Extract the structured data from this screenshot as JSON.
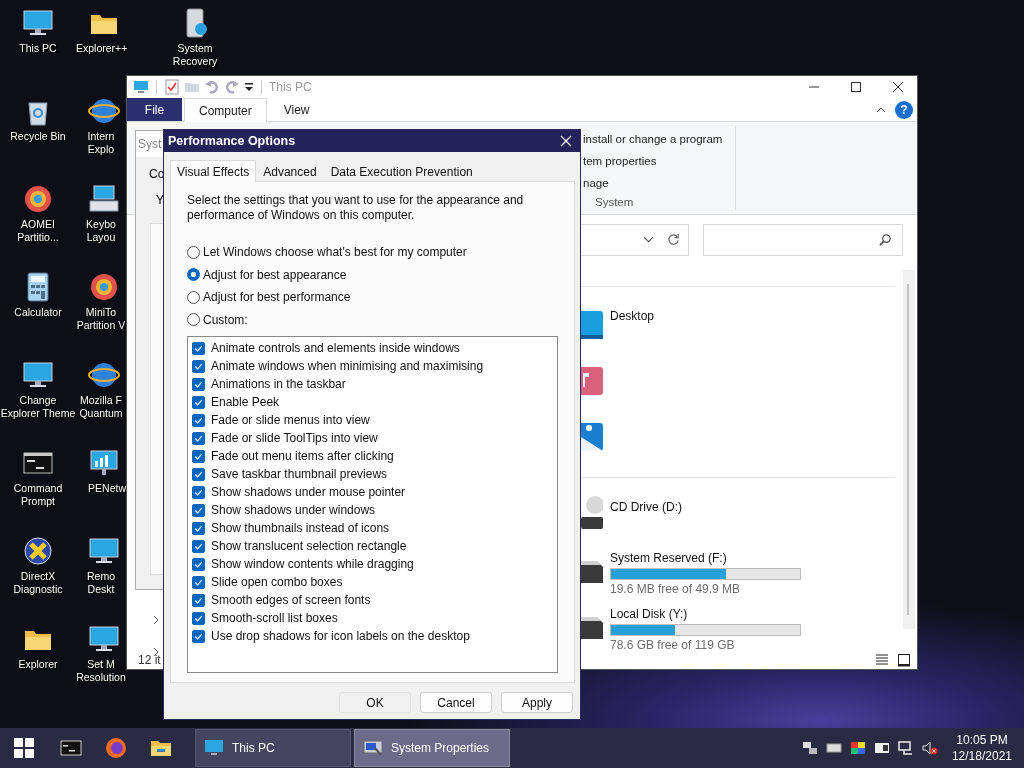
{
  "desktop": {
    "columns": [
      {
        "icons": [
          {
            "label": "This PC",
            "kind": "monitor"
          },
          {
            "label": "Recycle Bin",
            "kind": "bin"
          },
          {
            "label": "AOMEI Partitio...",
            "kind": "disc"
          },
          {
            "label": "Calculator",
            "kind": "calculator"
          },
          {
            "label": "Change Explorer Theme",
            "kind": "monitor"
          },
          {
            "label": "Command Prompt",
            "kind": "terminal"
          },
          {
            "label": "DirectX Diagnostic",
            "kind": "cross"
          },
          {
            "label": "Explorer",
            "kind": "folder"
          }
        ]
      },
      {
        "icons": [
          {
            "label": "Explorer++",
            "kind": "folder"
          },
          {
            "label": "Intern Explo",
            "kind": "globe"
          },
          {
            "label": "Keybo Layou",
            "kind": "keyboard"
          },
          {
            "label": "MiniTo Partition V",
            "kind": "disc"
          },
          {
            "label": "Mozilla F Quantum",
            "kind": "globe"
          },
          {
            "label": "PENetw",
            "kind": "network"
          },
          {
            "label": "Remo Deskt",
            "kind": "monitor"
          },
          {
            "label": "Set M Resolution",
            "kind": "monitor"
          }
        ]
      },
      {
        "icons": [
          {
            "label": "System Recovery",
            "kind": "drive"
          }
        ]
      }
    ]
  },
  "explorer": {
    "title": "This PC",
    "ribbon_tabs": [
      {
        "label": "File",
        "kind": "file",
        "selected": false
      },
      {
        "label": "Computer",
        "kind": "tab",
        "selected": true
      },
      {
        "label": "View",
        "kind": "tab",
        "selected": false
      }
    ],
    "help": "?",
    "ribbon_items": [
      "install or change a program",
      "tem properties",
      "nage"
    ],
    "ribbon_group": "System",
    "folders": [
      {
        "label": "Desktop",
        "kind": "desktop"
      },
      {
        "kind": "music"
      },
      {
        "kind": "pictures"
      }
    ],
    "drives": [
      {
        "label": "CD Drive (D:)",
        "kind": "cd"
      },
      {
        "label": "System Reserved (F:)",
        "kind": "disk",
        "level": 0.61,
        "free": "19.6 MB free of 49.9 MB"
      },
      {
        "label": "Local Disk (Y:)",
        "kind": "disk",
        "level": 0.34,
        "free": "78.6 GB free of 119 GB"
      }
    ],
    "status": "12 it"
  },
  "background_window": {
    "title": "Syst",
    "tab": "Co",
    "text": "Y"
  },
  "dialog": {
    "title": "Performance Options",
    "tabs": [
      {
        "label": "Visual Effects",
        "selected": true
      },
      {
        "label": "Advanced",
        "selected": false
      },
      {
        "label": "Data Execution Prevention",
        "selected": false
      }
    ],
    "intro": "Select the settings that you want to use for the appearance and performance of Windows on this computer.",
    "options": [
      {
        "label": "Let Windows choose what's best for my computer",
        "selected": false
      },
      {
        "label": "Adjust for best appearance",
        "selected": true
      },
      {
        "label": "Adjust for best performance",
        "selected": false
      },
      {
        "label": "Custom:",
        "selected": false
      }
    ],
    "effects": [
      {
        "label": "Animate controls and elements inside windows",
        "checked": true
      },
      {
        "label": "Animate windows when minimising and maximising",
        "checked": true
      },
      {
        "label": "Animations in the taskbar",
        "checked": true
      },
      {
        "label": "Enable Peek",
        "checked": true
      },
      {
        "label": "Fade or slide menus into view",
        "checked": true
      },
      {
        "label": "Fade or slide ToolTips into view",
        "checked": true
      },
      {
        "label": "Fade out menu items after clicking",
        "checked": true
      },
      {
        "label": "Save taskbar thumbnail previews",
        "checked": true
      },
      {
        "label": "Show shadows under mouse pointer",
        "checked": true
      },
      {
        "label": "Show shadows under windows",
        "checked": true
      },
      {
        "label": "Show thumbnails instead of icons",
        "checked": true
      },
      {
        "label": "Show translucent selection rectangle",
        "checked": true
      },
      {
        "label": "Show window contents while dragging",
        "checked": true
      },
      {
        "label": "Slide open combo boxes",
        "checked": true
      },
      {
        "label": "Smooth edges of screen fonts",
        "checked": true
      },
      {
        "label": "Smooth-scroll list boxes",
        "checked": true
      },
      {
        "label": "Use drop shadows for icon labels on the desktop",
        "checked": true
      }
    ],
    "buttons": [
      {
        "label": "OK",
        "kind": "default"
      },
      {
        "label": "Cancel",
        "kind": "normal"
      },
      {
        "label": "Apply",
        "kind": "normal"
      }
    ]
  },
  "taskbar": {
    "pinned": [
      {
        "kind": "terminal"
      },
      {
        "kind": "globe"
      },
      {
        "kind": "folder"
      }
    ],
    "tasks": [
      {
        "label": "This PC",
        "kind": "monitor",
        "selected": false
      },
      {
        "label": "System Properties",
        "kind": "sysprops",
        "selected": true
      }
    ],
    "tray": [
      {
        "kind": "network"
      },
      {
        "kind": "keyboard"
      },
      {
        "kind": "palette"
      },
      {
        "kind": "display"
      },
      {
        "kind": "monitor"
      },
      {
        "kind": "speaker-muted"
      }
    ],
    "time": "10:05 PM",
    "date": "12/18/2021"
  }
}
